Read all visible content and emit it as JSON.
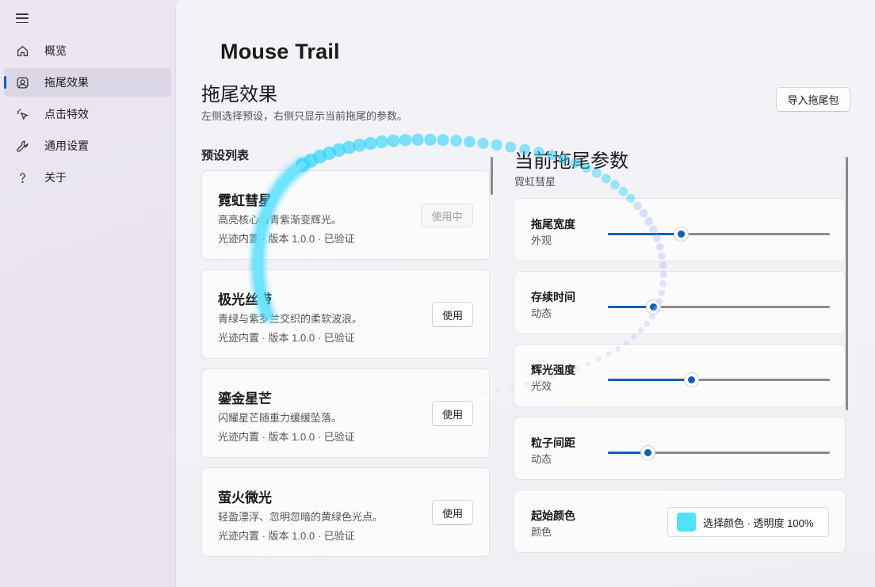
{
  "nav": {
    "menu_icon": "hamburger-icon",
    "items": [
      {
        "label": "概览",
        "icon": "home-icon"
      },
      {
        "label": "拖尾效果",
        "icon": "trail-image-icon"
      },
      {
        "label": "点击特效",
        "icon": "click-icon"
      },
      {
        "label": "通用设置",
        "icon": "wrench-icon"
      },
      {
        "label": "关于",
        "icon": "question-icon"
      }
    ],
    "active_index": 1
  },
  "header": {
    "app_title": "Mouse Trail",
    "section_title": "拖尾效果",
    "section_desc": "左侧选择预设，右侧只显示当前拖尾的参数。",
    "import_button": "导入拖尾包"
  },
  "presets": {
    "label": "预设列表",
    "items": [
      {
        "name": "霓虹彗星",
        "desc": "高亮核心与青紫渐变辉光。",
        "meta": "光迹内置 · 版本 1.0.0 · 已验证",
        "button": "使用中",
        "active": true
      },
      {
        "name": "极光丝带",
        "desc": "青绿与紫罗兰交织的柔软波浪。",
        "meta": "光迹内置 · 版本 1.0.0 · 已验证",
        "button": "使用",
        "active": false
      },
      {
        "name": "鎏金星芒",
        "desc": "闪耀星芒随重力缓缓坠落。",
        "meta": "光迹内置 · 版本 1.0.0 · 已验证",
        "button": "使用",
        "active": false
      },
      {
        "name": "萤火微光",
        "desc": "轻盈漂浮、忽明忽暗的黄绿色光点。",
        "meta": "光迹内置 · 版本 1.0.0 · 已验证",
        "button": "使用",
        "active": false
      }
    ]
  },
  "params": {
    "title": "当前拖尾参数",
    "current_preset": "霓虹彗星",
    "sliders": [
      {
        "name": "拖尾宽度",
        "sub": "外观",
        "value": 0.33
      },
      {
        "name": "存续时间",
        "sub": "动态",
        "value": 0.205
      },
      {
        "name": "辉光强度",
        "sub": "光效",
        "value": 0.375
      },
      {
        "name": "粒子间距",
        "sub": "动态",
        "value": 0.18
      }
    ],
    "start_color": {
      "name": "起始颜色",
      "sub": "颜色",
      "button_text": "选择颜色 · 透明度 100%",
      "swatch": "#4fe3f5"
    }
  },
  "colors": {
    "accent": "#0f5fb5",
    "trail": "#37d6fa"
  }
}
